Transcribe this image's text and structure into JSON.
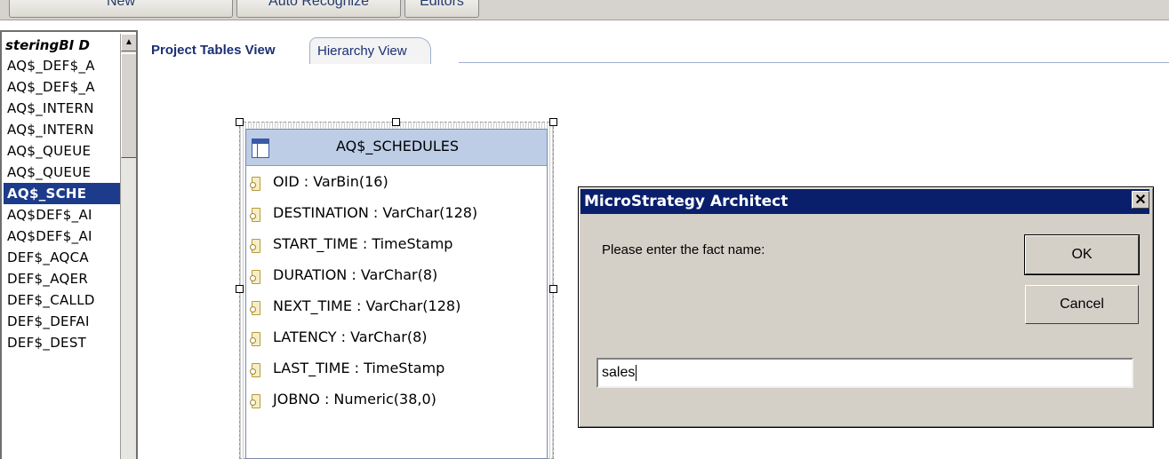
{
  "toolbar": {
    "buttons": [
      "New",
      "Auto Recognize",
      "Editors"
    ]
  },
  "left_panel": {
    "header": "steringBI D",
    "items": [
      "AQ$_DEF$_A",
      "AQ$_DEF$_A",
      "AQ$_INTERN",
      "AQ$_INTERN",
      "AQ$_QUEUE",
      "AQ$_QUEUE",
      "AQ$_SCHE",
      "AQ$DEF$_AI",
      "AQ$DEF$_AI",
      "DEF$_AQCA",
      "DEF$_AQER",
      "DEF$_CALLD",
      "DEF$_DEFAI",
      "DEF$_DEST"
    ],
    "selected_index": 6,
    "scroll_up_glyph": "▲"
  },
  "tabs": [
    {
      "label": "Project Tables View",
      "active": true
    },
    {
      "label": "Hierarchy View",
      "active": false
    }
  ],
  "table": {
    "name": "AQ$_SCHEDULES",
    "columns": [
      "OID : VarBin(16)",
      "DESTINATION : VarChar(128)",
      "START_TIME : TimeStamp",
      "DURATION : VarChar(8)",
      "NEXT_TIME : VarChar(128)",
      "LATENCY : VarChar(8)",
      "LAST_TIME : TimeStamp",
      "JOBNO : Numeric(38,0)"
    ]
  },
  "dialog": {
    "title": "MicroStrategy Architect",
    "close_glyph": "✕",
    "prompt": "Please enter the fact name:",
    "ok_label": "OK",
    "cancel_label": "Cancel",
    "input_value": "sales"
  },
  "colors": {
    "dialog_title_bg": "#0a1f6c",
    "selected_item_bg": "#1c3b8b",
    "table_header_bg": "#bdcde6"
  }
}
